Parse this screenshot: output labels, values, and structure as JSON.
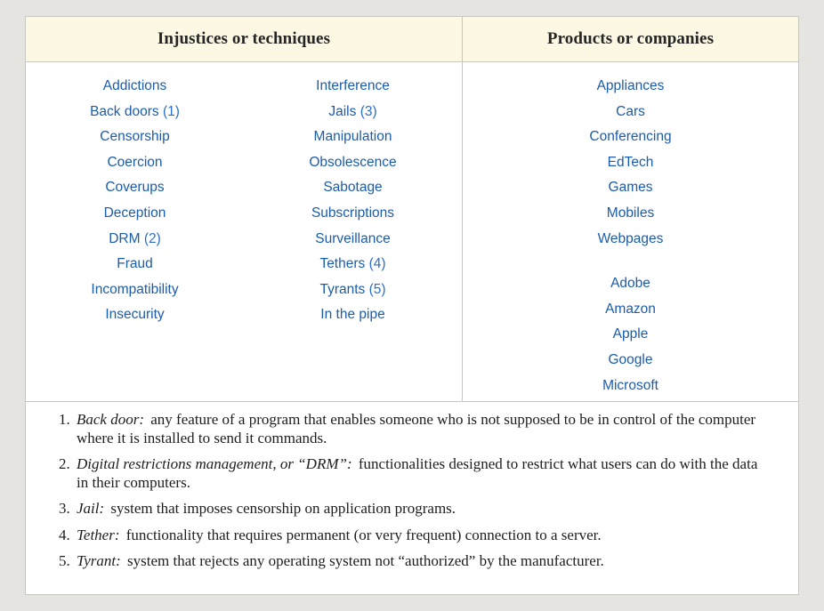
{
  "table": {
    "headers": [
      "Injustices or techniques",
      "Products or companies"
    ],
    "columns": [
      {
        "name": "injustices-column-1",
        "groups": [
          {
            "entries": [
              {
                "label": "Addictions",
                "ref": ""
              },
              {
                "label": "Back doors",
                "ref": "(1)"
              },
              {
                "label": "Censorship",
                "ref": ""
              },
              {
                "label": "Coercion",
                "ref": ""
              },
              {
                "label": "Coverups",
                "ref": ""
              },
              {
                "label": "Deception",
                "ref": ""
              },
              {
                "label": "DRM",
                "ref": "(2)"
              },
              {
                "label": "Fraud",
                "ref": ""
              },
              {
                "label": "Incompatibility",
                "ref": ""
              },
              {
                "label": "Insecurity",
                "ref": ""
              }
            ]
          }
        ]
      },
      {
        "name": "injustices-column-2",
        "groups": [
          {
            "entries": [
              {
                "label": "Interference",
                "ref": ""
              },
              {
                "label": "Jails",
                "ref": "(3)"
              },
              {
                "label": "Manipulation",
                "ref": ""
              },
              {
                "label": "Obsolescence",
                "ref": ""
              },
              {
                "label": "Sabotage",
                "ref": ""
              },
              {
                "label": "Subscriptions",
                "ref": ""
              },
              {
                "label": "Surveillance",
                "ref": ""
              },
              {
                "label": "Tethers",
                "ref": "(4)"
              },
              {
                "label": "Tyrants",
                "ref": "(5)"
              },
              {
                "label": "In the pipe",
                "ref": ""
              }
            ]
          }
        ]
      },
      {
        "name": "products-column",
        "groups": [
          {
            "entries": [
              {
                "label": "Appliances",
                "ref": ""
              },
              {
                "label": "Cars",
                "ref": ""
              },
              {
                "label": "Conferencing",
                "ref": ""
              },
              {
                "label": "EdTech",
                "ref": ""
              },
              {
                "label": "Games",
                "ref": ""
              },
              {
                "label": "Mobiles",
                "ref": ""
              },
              {
                "label": "Webpages",
                "ref": ""
              }
            ]
          },
          {
            "entries": [
              {
                "label": "Adobe",
                "ref": ""
              },
              {
                "label": "Amazon",
                "ref": ""
              },
              {
                "label": "Apple",
                "ref": ""
              },
              {
                "label": "Google",
                "ref": ""
              },
              {
                "label": "Microsoft",
                "ref": ""
              }
            ]
          }
        ]
      }
    ]
  },
  "notes": [
    {
      "term": "Back door:",
      "text": "any feature of a program that enables someone who is not supposed to be in control of the computer where it is installed to send it commands."
    },
    {
      "term": "Digital restrictions management, or “DRM”:",
      "text": "functionalities designed to restrict what users can do with the data in their computers."
    },
    {
      "term": "Jail:",
      "text": "system that imposes censorship on application programs."
    },
    {
      "term": "Tether:",
      "text": "functionality that requires permanent (or very frequent) connection to a server."
    },
    {
      "term": "Tyrant:",
      "text": "system that rejects any operating system not “authorized” by the manufacturer."
    }
  ],
  "colors": {
    "link": "#1b5cab",
    "note_ref_link": "#2b6fcc",
    "header_background": "#fdf8e3",
    "border": "#c6c6c2",
    "page_background": "#e5e4e0",
    "body_text": "#1d1d1d"
  }
}
